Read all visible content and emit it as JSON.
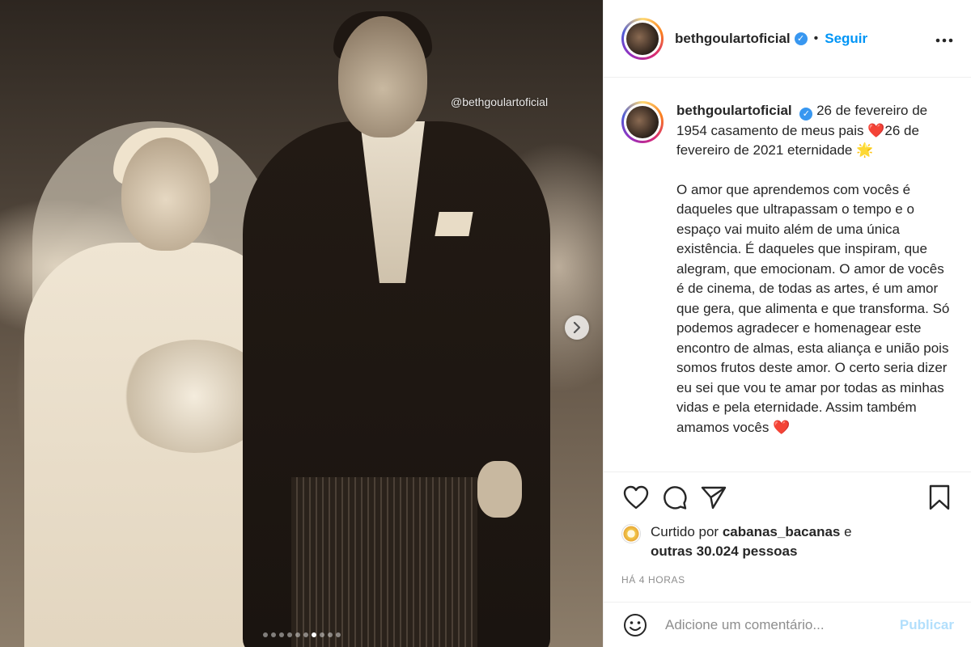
{
  "post": {
    "watermark": "@bethgoulartoficial",
    "carousel": {
      "total_slides": 10,
      "active_index": 6
    }
  },
  "header": {
    "username": "bethgoulartoficial",
    "separator": "•",
    "follow_label": "Seguir",
    "more_label": "•••"
  },
  "caption": {
    "username": "bethgoulartoficial",
    "line1": "26 de fevereiro de 1954 casamento de meus pais ❤️26 de fevereiro de 2021 eternidade 🌟",
    "body": "O amor que aprendemos com vocês é daqueles que ultrapassam o tempo e o espaço vai muito além de uma única existência. É daqueles que inspiram, que alegram, que emocionam. O amor de vocês é de cinema, de todas as artes, é um amor que gera, que alimenta e que transforma. Só podemos agradecer e homenagear este encontro de almas, esta aliança e união pois somos frutos deste amor. O certo seria dizer eu sei que vou te amar por todas as minhas vidas e pela eternidade. Assim também amamos vocês ❤️"
  },
  "likes": {
    "prefix": "Curtido por",
    "user": "cabanas_bacanas",
    "connector": "e",
    "others": "outras 30.024 pessoas"
  },
  "timestamp": "HÁ 4 HORAS",
  "comment": {
    "placeholder": "Adicione um comentário...",
    "publish_label": "Publicar"
  },
  "icons": {
    "like": "heart-icon",
    "comment": "comment-icon",
    "share": "share-icon",
    "save": "bookmark-icon",
    "emoji": "emoji-icon",
    "next": "chevron-right-icon",
    "verified": "verified-badge-icon"
  },
  "colors": {
    "accent": "#0095f6",
    "verified": "#3897f0",
    "publish_disabled": "#b2dffc",
    "muted": "#8e8e8e"
  }
}
